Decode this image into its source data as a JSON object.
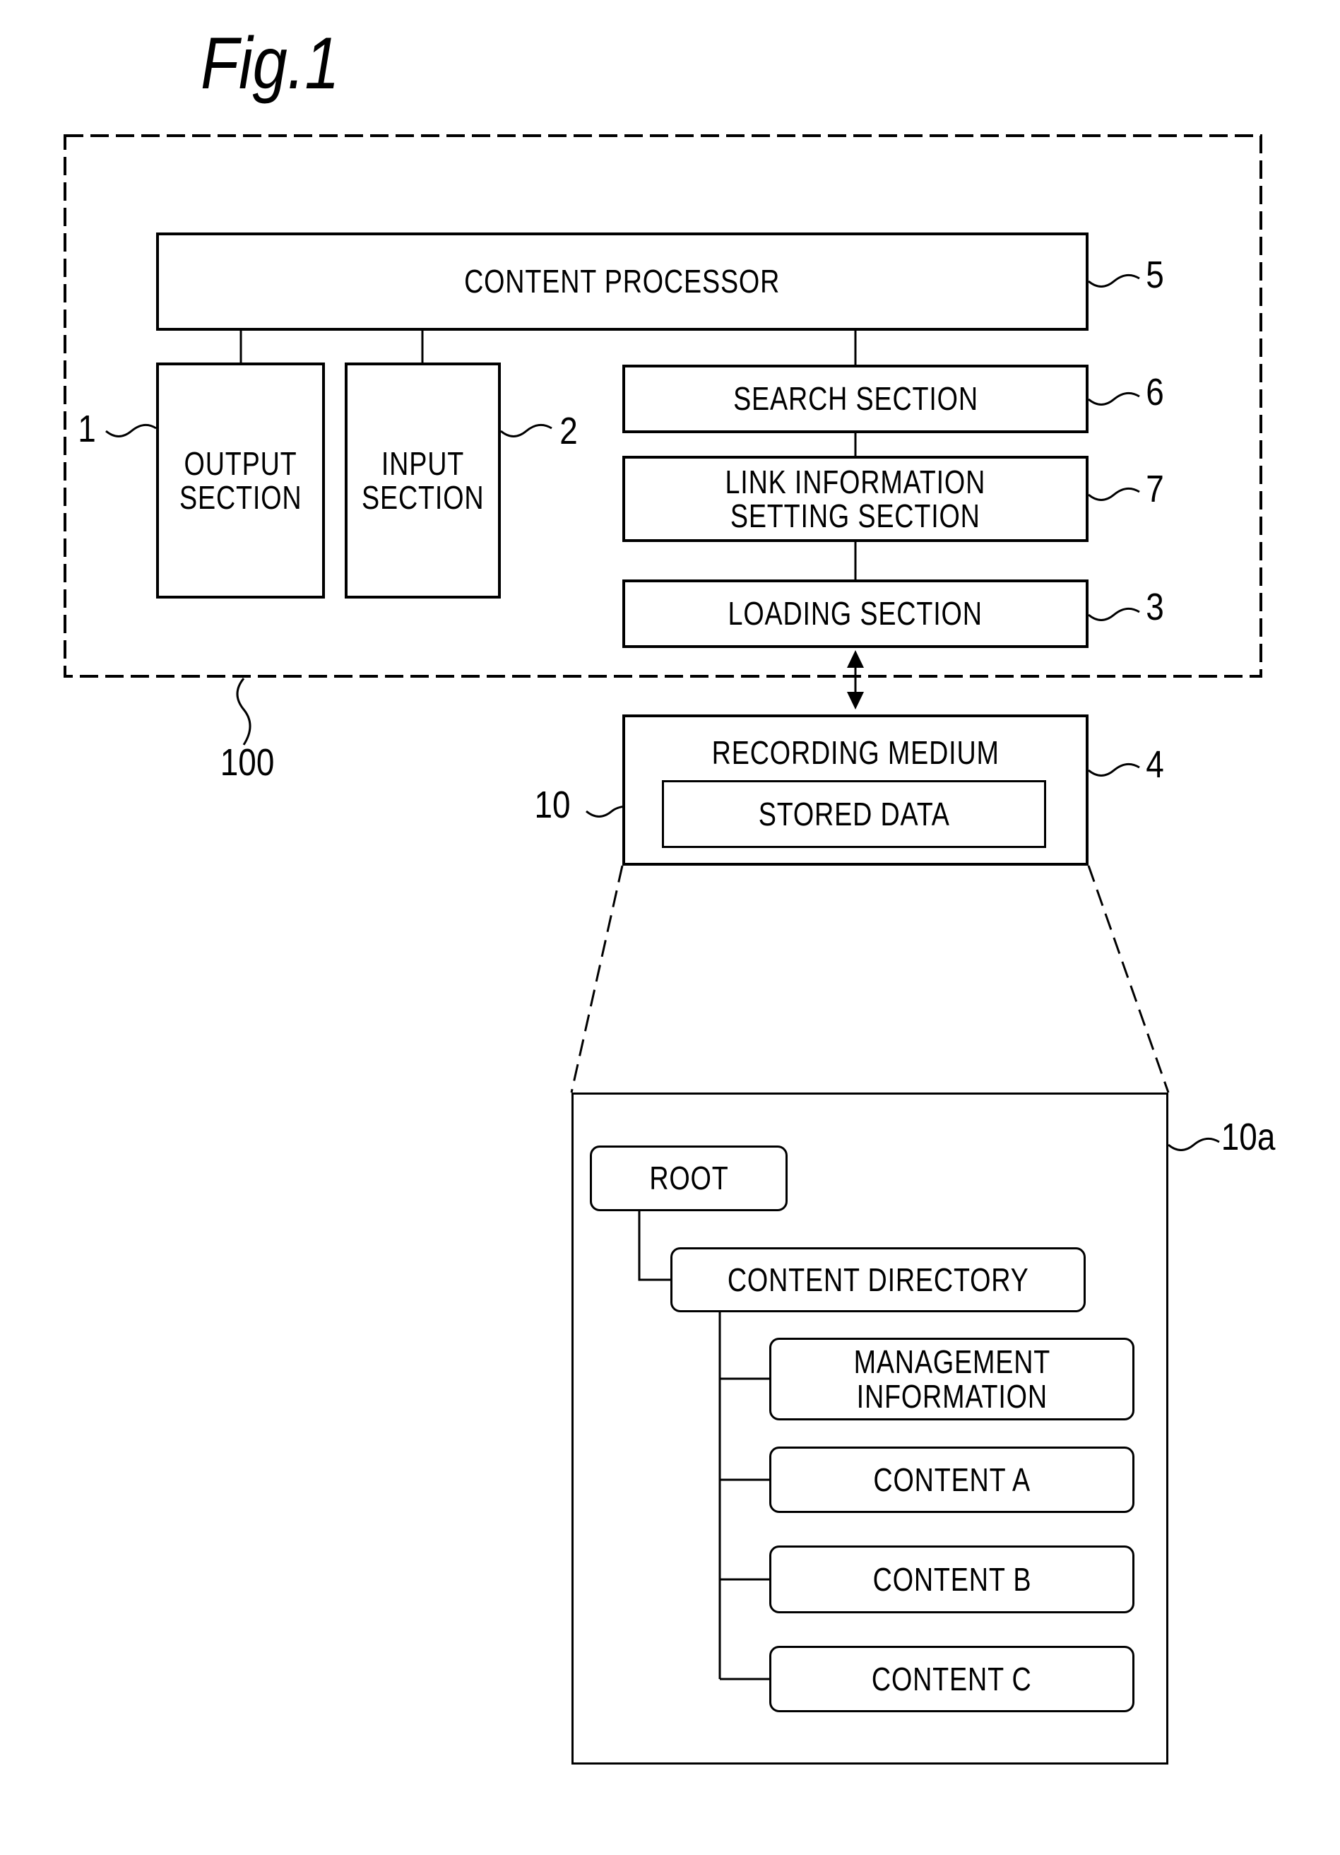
{
  "figure": {
    "title": "Fig.1"
  },
  "device": {
    "ref": "100",
    "content_processor": {
      "label": "CONTENT PROCESSOR",
      "ref": "5"
    },
    "output_section": {
      "line1": "OUTPUT",
      "line2": "SECTION",
      "ref": "1"
    },
    "input_section": {
      "line1": "INPUT",
      "line2": "SECTION",
      "ref": "2"
    },
    "search_section": {
      "label": "SEARCH SECTION",
      "ref": "6"
    },
    "link_section": {
      "line1": "LINK INFORMATION",
      "line2": "SETTING SECTION",
      "ref": "7"
    },
    "loading_section": {
      "label": "LOADING SECTION",
      "ref": "3"
    }
  },
  "recording_medium": {
    "label": "RECORDING MEDIUM",
    "ref": "4",
    "stored_data": {
      "label": "STORED DATA",
      "ref": "10"
    }
  },
  "directory_tree": {
    "ref": "10a",
    "root": "ROOT",
    "content_directory": "CONTENT DIRECTORY",
    "children": [
      {
        "line1": "MANAGEMENT",
        "line2": "INFORMATION"
      },
      {
        "line1": "CONTENT A"
      },
      {
        "line1": "CONTENT B"
      },
      {
        "line1": "CONTENT C"
      }
    ]
  }
}
